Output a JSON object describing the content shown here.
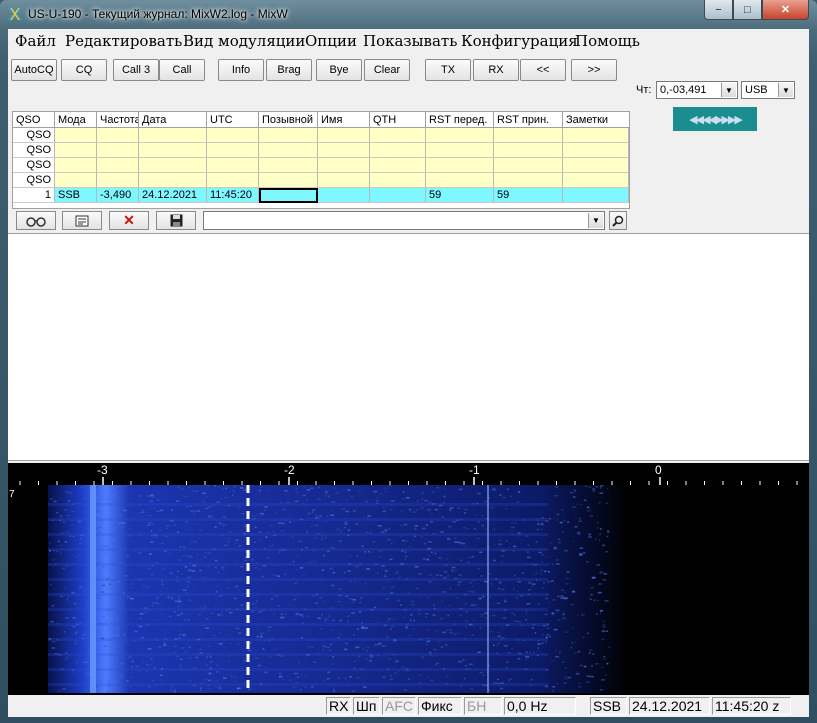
{
  "window": {
    "title": "US-U-190 - Текущий журнал: MixW2.log - MixW",
    "min_label": "−",
    "max_label": "□",
    "close_label": "✕"
  },
  "menu": [
    "Файл",
    "Редактировать",
    "Вид модуляции",
    "Опции",
    "Показывать",
    "Конфигурация",
    "Помощь"
  ],
  "toolbar": {
    "buttons": [
      "AutoCQ",
      "CQ",
      "Call 3",
      "Call",
      "Info",
      "Brag",
      "Bye",
      "Clear",
      "TX",
      "RX",
      "<<",
      ">>"
    ]
  },
  "rightpanel": {
    "ch_label": "Чт:",
    "freq_value": "0,-03,491",
    "mode_value": "USB",
    "arrows_label": "◀◀◀◀▶▶▶▶"
  },
  "log": {
    "headers": [
      "QSO",
      "Мода",
      "Частота",
      "Дата",
      "UTC",
      "Позывной",
      "Имя",
      "QTH",
      "RST перед.",
      "RST прин.",
      "Заметки"
    ],
    "rows": [
      [
        "QSO",
        "",
        "",
        "",
        "",
        "",
        "",
        "",
        "",
        "",
        ""
      ],
      [
        "QSO",
        "",
        "",
        "",
        "",
        "",
        "",
        "",
        "",
        "",
        ""
      ],
      [
        "QSO",
        "",
        "",
        "",
        "",
        "",
        "",
        "",
        "",
        "",
        ""
      ],
      [
        "QSO",
        "",
        "",
        "",
        "",
        "",
        "",
        "",
        "",
        "",
        ""
      ],
      [
        "1",
        "SSB",
        "-3,490",
        "24.12.2021",
        "11:45:20",
        "",
        "",
        "",
        "59",
        "59",
        ""
      ]
    ]
  },
  "filterbar": {
    "combo_value": ""
  },
  "waterfall": {
    "scale_labels": [
      "-3",
      "-2",
      "-1",
      "0"
    ],
    "side_mark": "7"
  },
  "status": {
    "rx": "RX",
    "shp": "Шп",
    "afc": "AFC",
    "fix": "Фикс",
    "bn": "БН",
    "offset": "0,0 Hz",
    "mode": "SSB",
    "date": "24.12.2021",
    "time": "11:45:20 z"
  },
  "colors": {
    "title_bar": "#4c6c7c",
    "log_yellow": "#ffffc6",
    "log_cyan": "#7ff7ff",
    "waterfall_bg": "#000000",
    "waterfall_signal": "#1e3ec8",
    "arrows_bg": "#1a8e8e"
  }
}
